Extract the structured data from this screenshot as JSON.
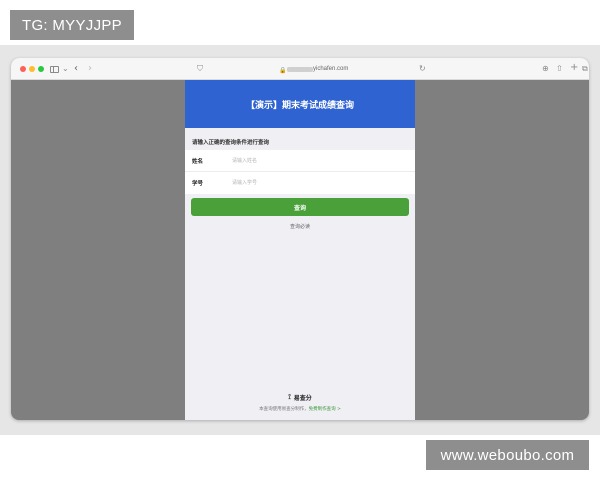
{
  "watermarks": {
    "top_left": "TG: MYYJJPP",
    "bottom_right": "www.weboubo.com"
  },
  "browser": {
    "url": "yichafen.com",
    "icons": {
      "sidebar": "sidebar-icon",
      "back": "‹",
      "forward": "›",
      "chevron_down": "⌄",
      "shield": "⛉",
      "lock": "🔒",
      "reload": "↻",
      "download": "⊕",
      "share": "⇧",
      "new_tab": "+",
      "tabs": "⧉"
    }
  },
  "page": {
    "header_title": "【演示】期末考试成绩查询",
    "hint": "请输入正确的查询条件进行查询",
    "fields": [
      {
        "label": "姓名",
        "placeholder": "请输入姓名",
        "value": ""
      },
      {
        "label": "学号",
        "placeholder": "请输入学号",
        "value": ""
      }
    ],
    "query_button": "查询",
    "notice": "查询必读",
    "brand_name": "易查分",
    "footer_text": "本查询使用易查分制作，",
    "footer_link": "免费制作查询 >"
  },
  "colors": {
    "header": "#2f63d1",
    "button": "#4aa13a",
    "link": "#3a9a3a",
    "viewport_background": "#7f7f7f"
  }
}
